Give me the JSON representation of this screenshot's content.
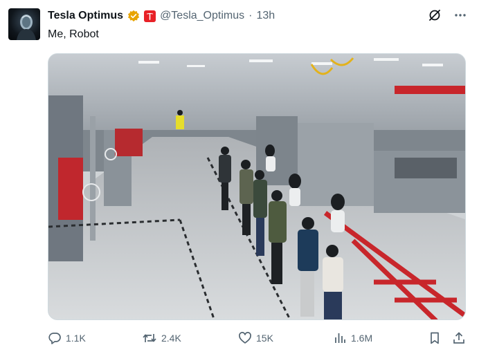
{
  "tweet": {
    "display_name": "Tesla Optimus",
    "handle": "@Tesla_Optimus",
    "separator": "·",
    "time": "13h",
    "text": "Me, Robot",
    "verified_badge_color": "#e8a400",
    "brand_badge_color": "#e82127"
  },
  "icons": {
    "grok": "grok-icon",
    "more": "more-icon",
    "reply": "reply-icon",
    "repost": "repost-icon",
    "like": "heart-icon",
    "views": "bar-chart-icon",
    "bookmark": "bookmark-icon",
    "share": "share-icon"
  },
  "media": {
    "description_type": "photo",
    "accent_red": "#c8262b",
    "floor_color": "#c9cccf"
  },
  "actions": {
    "replies": "1.1K",
    "reposts": "2.4K",
    "likes": "15K",
    "views": "1.6M"
  }
}
